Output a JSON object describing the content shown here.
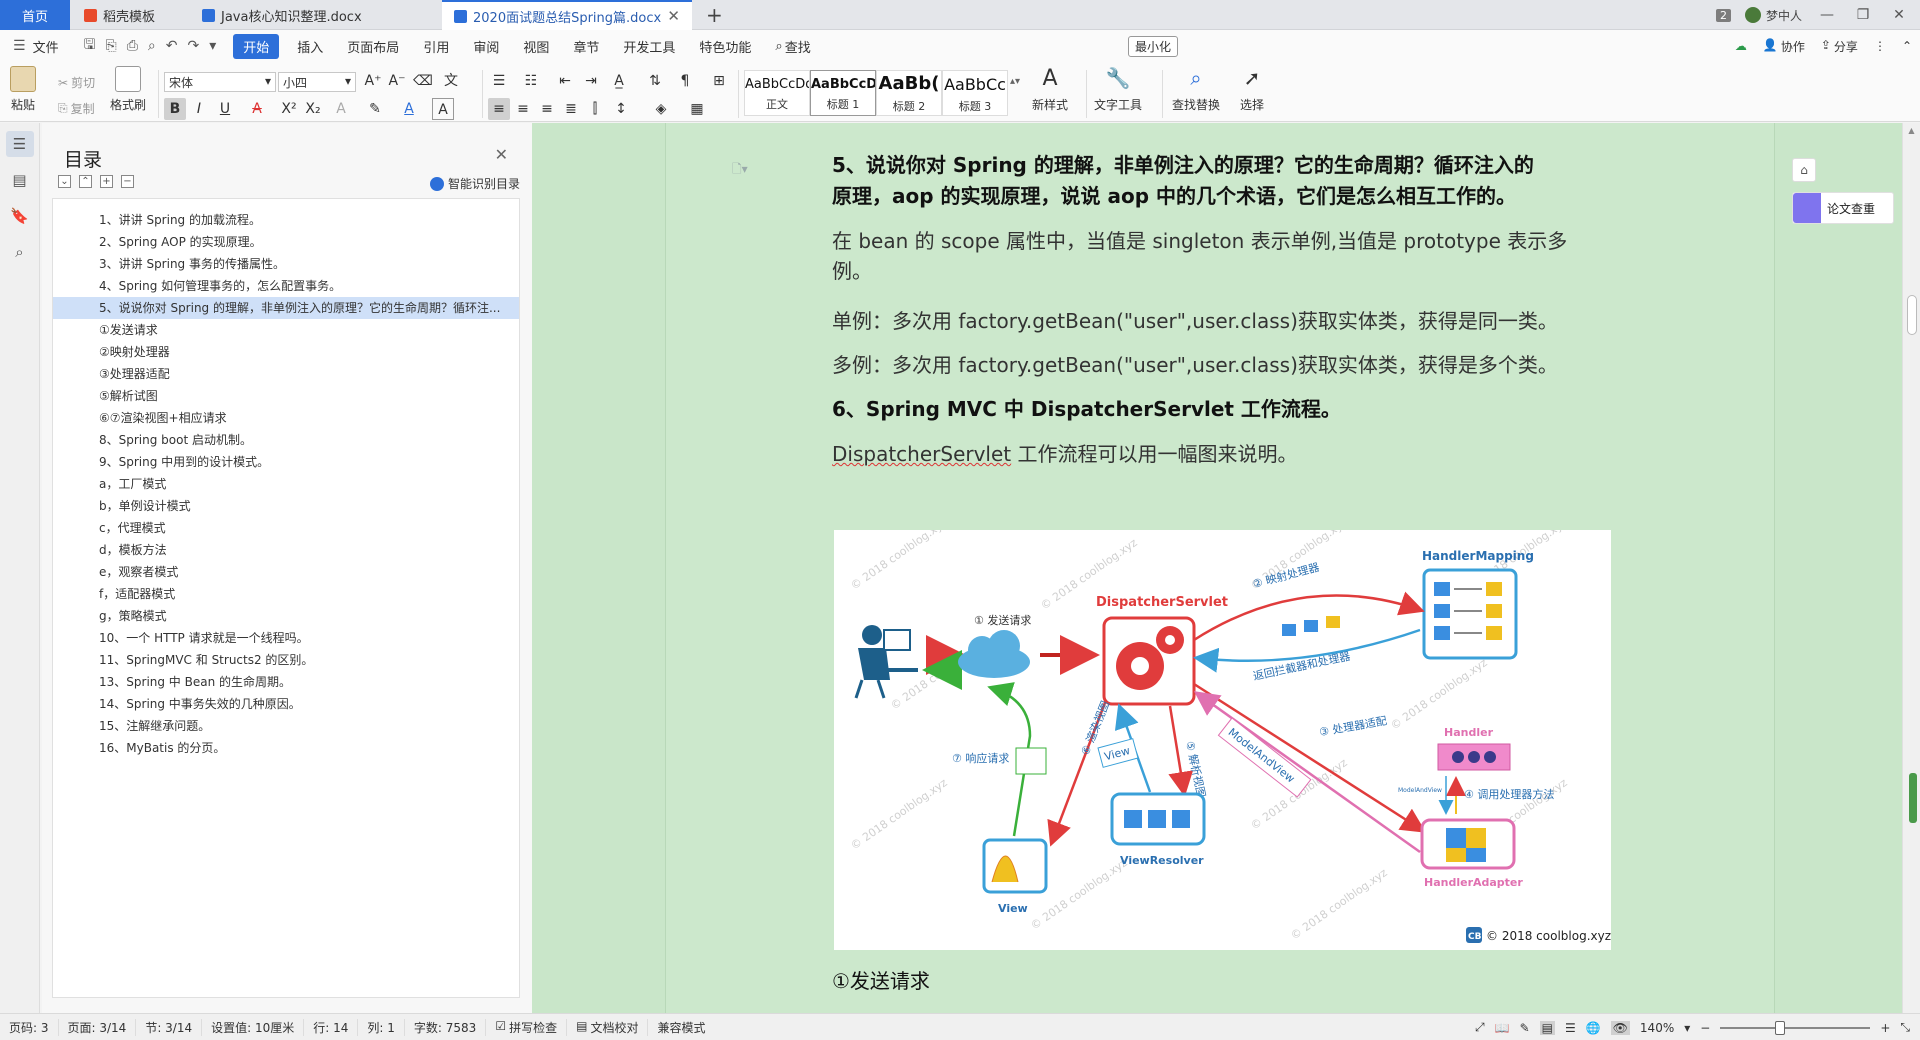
{
  "tabs": {
    "home": "首页",
    "template": "稻壳模板",
    "doc1": "Java核心知识整理.docx",
    "doc2": "2020面试题总结Spring篇.docx",
    "new_tab": "+"
  },
  "titlebar": {
    "count": "2",
    "user": "梦中人"
  },
  "menu": {
    "file": "文件",
    "items": [
      "开始",
      "插入",
      "页面布局",
      "引用",
      "审阅",
      "视图",
      "章节",
      "开发工具",
      "特色功能"
    ],
    "search": "查找",
    "minimize_chip": "最小化",
    "collab": "协作",
    "share": "分享"
  },
  "ribbon": {
    "paste": "粘贴",
    "cut": "剪切",
    "copy": "复制",
    "format_painter": "格式刷",
    "font_name": "宋体",
    "font_size": "小四",
    "styles": [
      {
        "sample": "AaBbCcDd",
        "name": "正文"
      },
      {
        "sample": "AaBbCcDd",
        "name": "标题 1"
      },
      {
        "sample": "AaBb(",
        "name": "标题 2"
      },
      {
        "sample": "AaBbCc",
        "name": "标题 3"
      }
    ],
    "new_style": "新样式",
    "text_tools": "文字工具",
    "find_replace": "查找替换",
    "select": "选择"
  },
  "toc": {
    "title": "目录",
    "smart": "智能识别目录",
    "items": [
      "1、讲讲 Spring 的加载流程。",
      "2、Spring AOP 的实现原理。",
      "3、讲讲 Spring 事务的传播属性。",
      "4、Spring 如何管理事务的，怎么配置事务。",
      "5、说说你对 Spring 的理解，非单例注入的原理？它的生命周期？循环注...",
      "①发送请求",
      "②映射处理器",
      "③处理器适配",
      "⑤解析试图",
      "⑥⑦渲染视图+相应请求",
      "8、Spring boot 启动机制。",
      "9、Spring 中用到的设计模式。",
      "a，工厂模式",
      "b，单例设计模式",
      "c，代理模式",
      "d，模板方法",
      "e，观察者模式",
      "f，适配器模式",
      "g，策略模式",
      "10、一个 HTTP 请求就是一个线程吗。",
      "11、SpringMVC 和 Structs2 的区别。",
      "13、Spring 中 Bean 的生命周期。",
      "14、Spring 中事务失效的几种原因。",
      "15、注解继承问题。",
      "16、MyBatis 的分页。"
    ]
  },
  "doc": {
    "heading5_line1": "5、说说你对 Spring 的理解，非单例注入的原理？它的生命周期？循环注入的",
    "heading5_line2": "原理，aop 的实现原理，说说 aop 中的几个术语，它们是怎么相互工作的。",
    "para1_line1": "在 bean 的 scope 属性中，当值是 singleton 表示单例,当值是 prototype 表示多",
    "para1_line2": "例。",
    "para2": "单例：多次用 factory.getBean(\"user\",user.class)获取实体类，获得是同一类。",
    "para3": "多例：多次用 factory.getBean(\"user\",user.class)获取实体类，获得是多个类。",
    "heading6": "6、Spring MVC 中 DispatcherServlet 工作流程。",
    "para4_word": "DispatcherServlet",
    "para4_rest": " 工作流程可以用一幅图来说明。",
    "after_figure": "①发送请求"
  },
  "figure": {
    "dispatcher": "DispatcherServlet",
    "handler_mapping": "HandlerMapping",
    "handler": "Handler",
    "handler_adapter": "HandlerAdapter",
    "view": "View",
    "view_resolver": "ViewResolver",
    "step1": "① 发送请求",
    "step2": "② 映射处理器",
    "step2b": "返回拦截器和处理器",
    "step3": "③ 处理器适配",
    "step4": "④ 调用处理器方法",
    "step5": "⑤ 解析视图",
    "step6": "⑥ 渲染视图",
    "step7": "⑦ 响应请求",
    "model_and_view": "ModelAndView",
    "view_box": "View",
    "model_and_view_small": "ModelAndView",
    "copyright": "© 2018 coolblog.xyz",
    "logo": "CB",
    "watermark": "© 2018 coolblog.xyz"
  },
  "side": {
    "paper_check": "论文查重"
  },
  "status": {
    "page_code": "页码: 3",
    "page": "页面: 3/14",
    "section": "节: 3/14",
    "setting": "设置值: 10厘米",
    "row": "行: 14",
    "col": "列: 1",
    "words": "字数: 7583",
    "spell": "拼写检查",
    "doc_check": "文档校对",
    "compat": "兼容模式",
    "zoom": "140%",
    "zoom_level": 0.4
  },
  "colors": {
    "accent": "#2d6fd9",
    "page_bg": "#cce8cc",
    "red": "#e03c3c",
    "blue": "#3aa0d8"
  }
}
